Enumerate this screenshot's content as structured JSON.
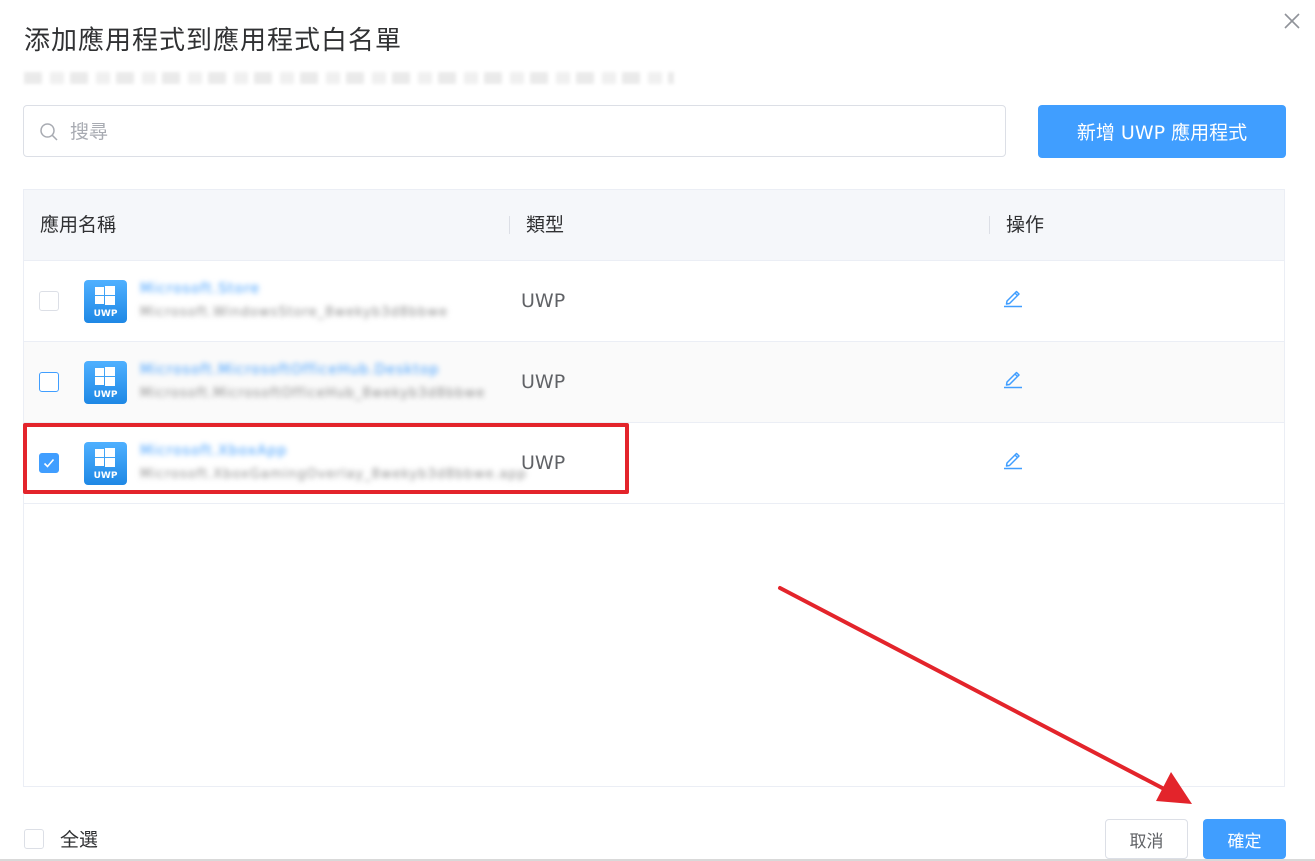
{
  "dialog": {
    "title": "添加應用程式到應用程式白名單"
  },
  "search": {
    "placeholder": "搜尋",
    "value": ""
  },
  "toolbar": {
    "add_uwp_label": "新增 UWP 應用程式"
  },
  "table": {
    "columns": [
      "應用名稱",
      "類型",
      "操作"
    ],
    "rows": [
      {
        "icon_label": "UWP",
        "name": "Microsoft.Store",
        "package_id": "Microsoft.WindowsStore_8wekyb3d8bbwe",
        "type": "UWP",
        "checked": false
      },
      {
        "icon_label": "UWP",
        "name": "Microsoft.MicrosoftOfficeHub.Desktop",
        "package_id": "Microsoft.MicrosoftOfficeHub_8wekyb3d8bbwe",
        "type": "UWP",
        "checked": false
      },
      {
        "icon_label": "UWP",
        "name": "Microsoft.XboxApp",
        "package_id": "Microsoft.XboxGamingOverlay_8wekyb3d8bbwe.app",
        "type": "UWP",
        "checked": true
      }
    ]
  },
  "footer": {
    "select_all_label": "全選",
    "cancel_label": "取消",
    "confirm_label": "確定"
  },
  "colors": {
    "primary": "#409eff",
    "annotation_red": "#e3242b"
  }
}
